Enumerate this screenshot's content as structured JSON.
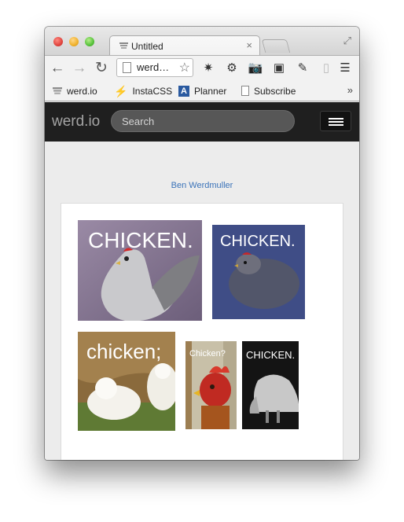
{
  "window": {
    "tab_title": "Untitled",
    "tab_close": "×",
    "fullscreen_icon": "fullscreen-icon"
  },
  "toolbar": {
    "back": "back-arrow-icon",
    "forward": "forward-arrow-icon",
    "reload": "reload-icon",
    "url": "werd…",
    "star": "☆",
    "menu": "menu-icon"
  },
  "bookmarks": [
    {
      "label": "werd.io",
      "icon": "werd-favicon-icon"
    },
    {
      "label": "InstaCSS",
      "icon": "bolt-icon"
    },
    {
      "label": "Planner",
      "icon": "planner-a-icon"
    },
    {
      "label": "Subscribe",
      "icon": "page-icon"
    }
  ],
  "bookmarks_more": "»",
  "site": {
    "logo": "werd.io",
    "search_placeholder": "Search",
    "author_link": "Ben Werdmuller"
  },
  "photos": [
    {
      "caption": "CHICKEN.",
      "theme": "grey rooster on purple background"
    },
    {
      "caption": "CHICKEN.",
      "theme": "dark fluffy hen on blue background"
    },
    {
      "caption": "chicken;",
      "theme": "white silkie chickens on straw"
    },
    {
      "caption": "Chicken?",
      "theme": "red rooster head close-up"
    },
    {
      "caption": "CHICKEN.",
      "theme": "grey chicken on black background"
    }
  ],
  "colors": {
    "header_bg": "#1f1f1f",
    "link": "#3b73b9",
    "page_bg": "#ececec"
  }
}
